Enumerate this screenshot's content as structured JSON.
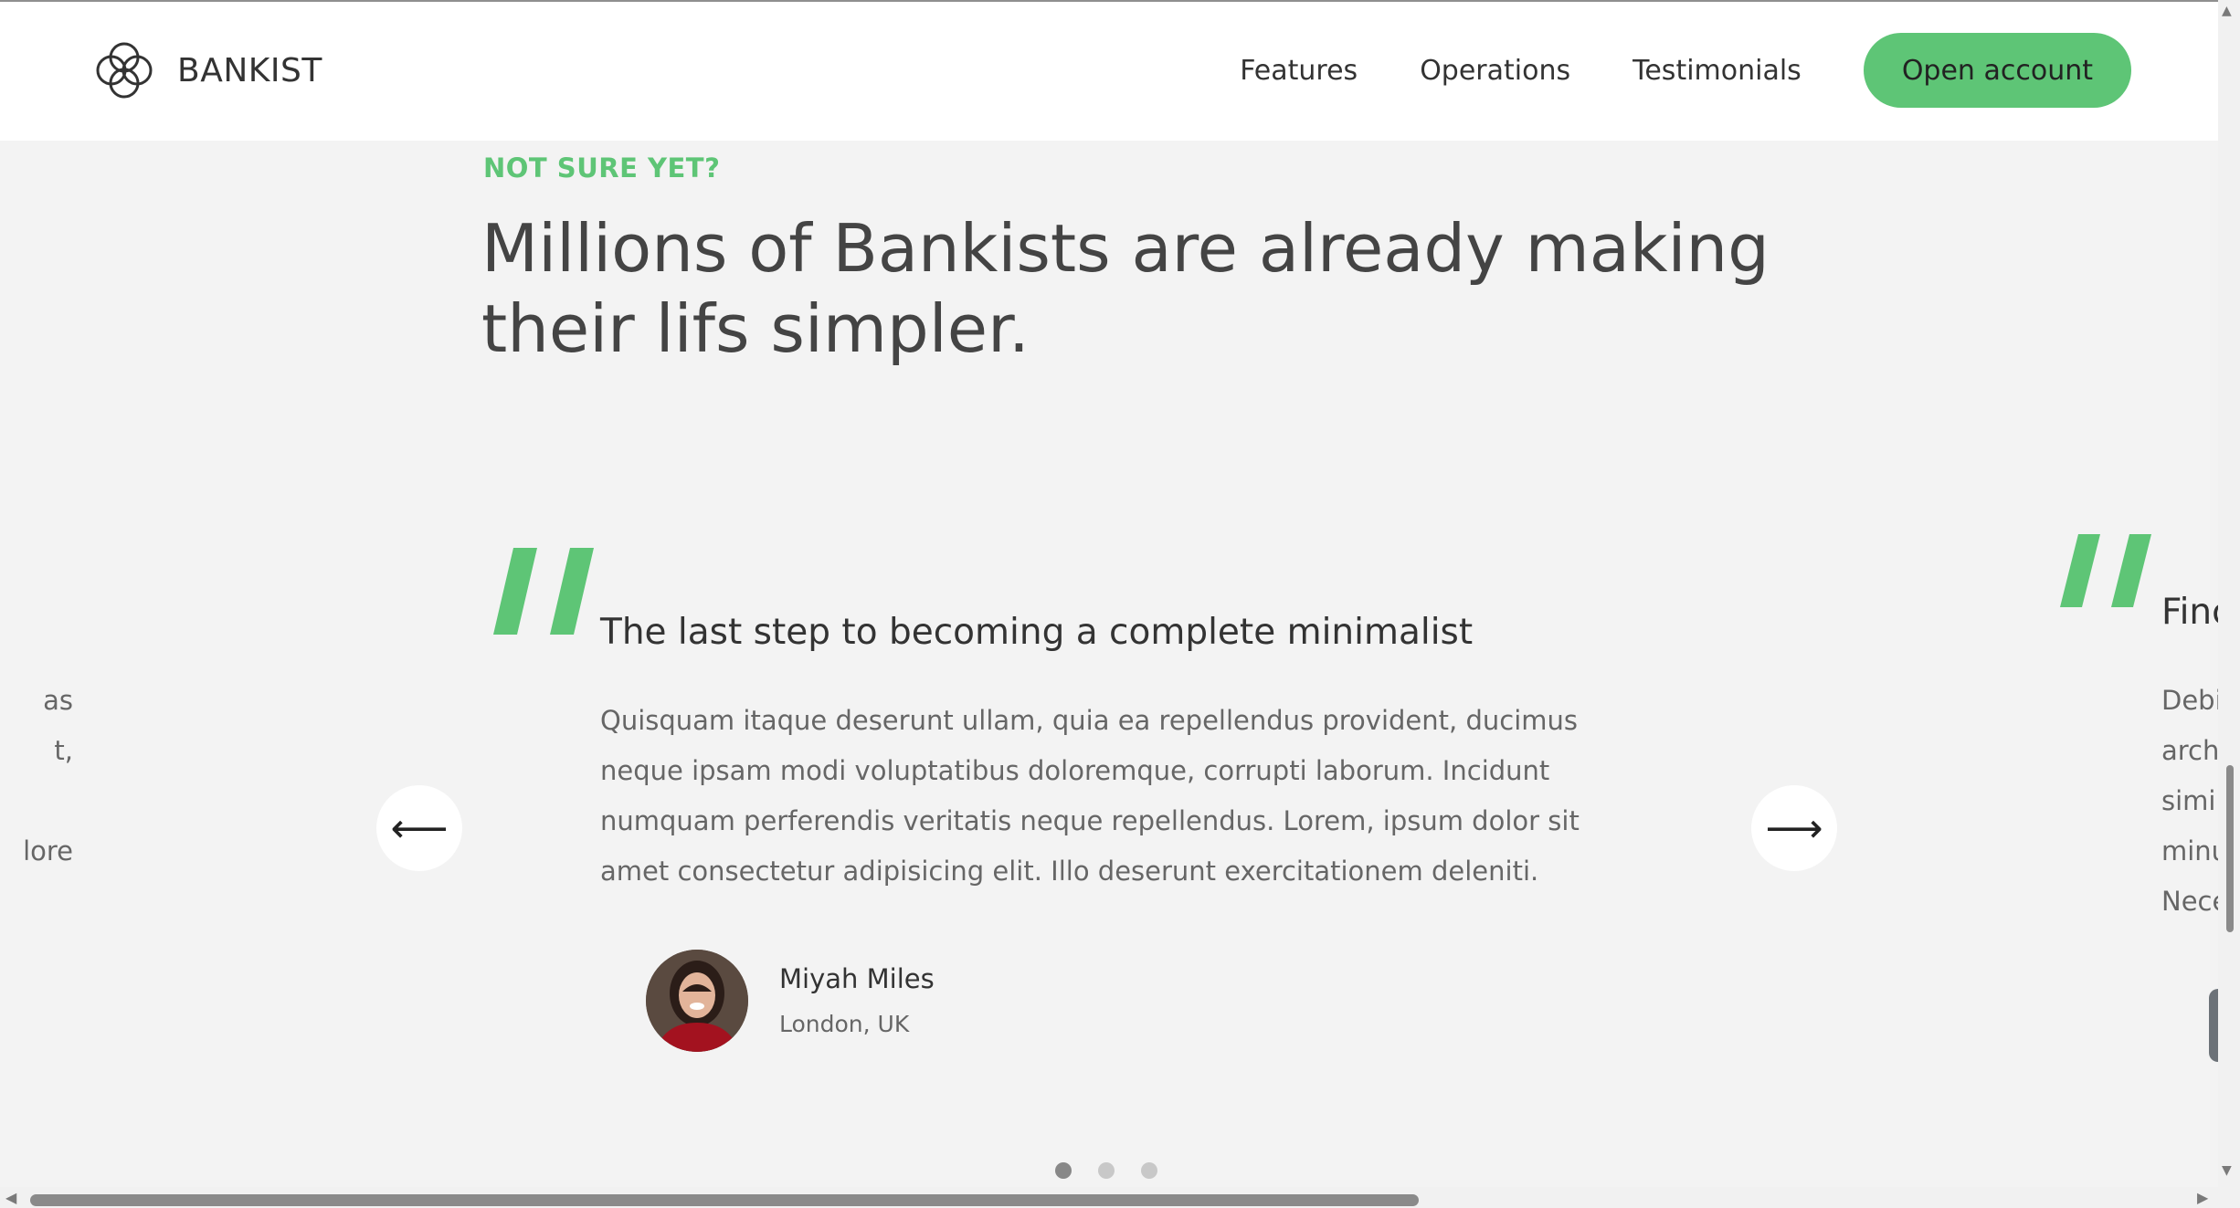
{
  "nav": {
    "logo_text": "BANKIST",
    "links": [
      "Features",
      "Operations",
      "Testimonials"
    ],
    "cta": "Open account"
  },
  "section": {
    "eyebrow": "NOT SURE YET?",
    "headline": "Millions of Bankists are already making their lifs simpler."
  },
  "slider": {
    "prev_arrow": "⟵",
    "next_arrow": "⟶",
    "current": {
      "title": "The last step to becoming a complete minimalist",
      "body": "Quisquam itaque deserunt ullam, quia ea repellendus provident, ducimus neque ipsam modi voluptatibus doloremque, corrupti laborum. Incidunt numquam perferendis veritatis neque repellendus. Lorem, ipsum dolor sit amet consectetur adipisicing elit. Illo deserunt exercitationem deleniti.",
      "author_name": "Miyah Miles",
      "author_location": "London, UK"
    },
    "prev_slide_lines": [
      "as",
      "t,",
      "",
      "lore"
    ],
    "next_slide_title": "Finc",
    "next_slide_lines": [
      "Debi",
      "arch",
      "simil",
      "minu",
      "Nece"
    ],
    "dots": 3,
    "active_dot": 0
  },
  "colors": {
    "accent": "#5ec576",
    "text": "#444444",
    "background": "#f3f3f3"
  }
}
